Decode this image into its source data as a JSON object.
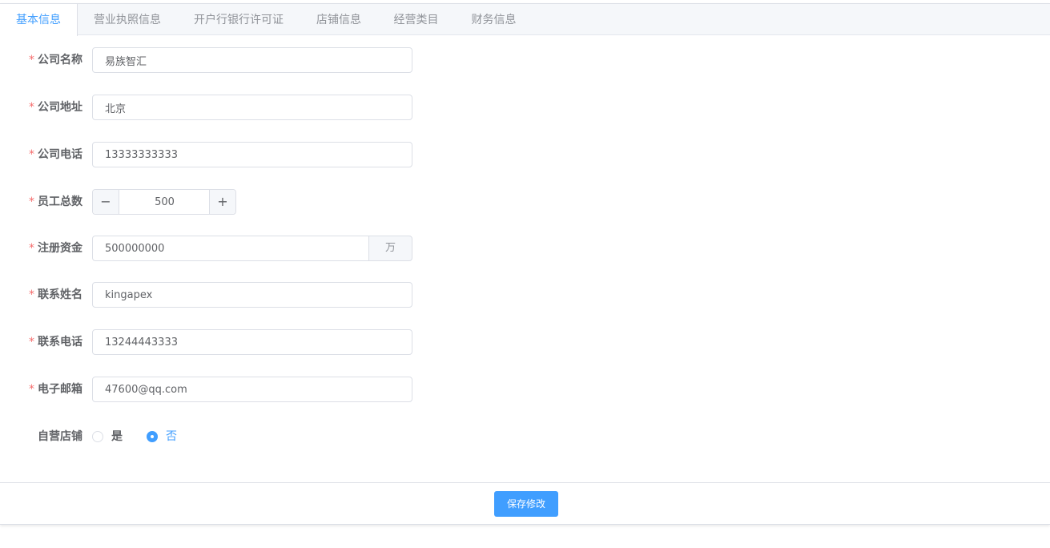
{
  "tabs": [
    {
      "label": "基本信息",
      "active": true
    },
    {
      "label": "营业执照信息",
      "active": false
    },
    {
      "label": "开户行银行许可证",
      "active": false
    },
    {
      "label": "店铺信息",
      "active": false
    },
    {
      "label": "经营类目",
      "active": false
    },
    {
      "label": "财务信息",
      "active": false
    }
  ],
  "form": {
    "required_mark": "*",
    "company_name": {
      "label": "公司名称",
      "value": "易族智汇"
    },
    "company_address": {
      "label": "公司地址",
      "value": "北京"
    },
    "company_phone": {
      "label": "公司电话",
      "value": "13333333333"
    },
    "employee_count": {
      "label": "员工总数",
      "value": "500",
      "minus": "−",
      "plus": "+"
    },
    "registered_capital": {
      "label": "注册资金",
      "value": "500000000",
      "unit": "万"
    },
    "contact_name": {
      "label": "联系姓名",
      "value": "kingapex"
    },
    "contact_phone": {
      "label": "联系电话",
      "value": "13244443333"
    },
    "email": {
      "label": "电子邮箱",
      "value": "47600@qq.com"
    },
    "self_operated": {
      "label": "自营店铺",
      "options": [
        {
          "label": "是",
          "checked": false
        },
        {
          "label": "否",
          "checked": true
        }
      ]
    }
  },
  "footer": {
    "save_label": "保存修改"
  },
  "colors": {
    "primary": "#409eff",
    "required": "#f56c6c",
    "text": "#606266",
    "muted": "#909399",
    "border": "#dcdfe6"
  }
}
